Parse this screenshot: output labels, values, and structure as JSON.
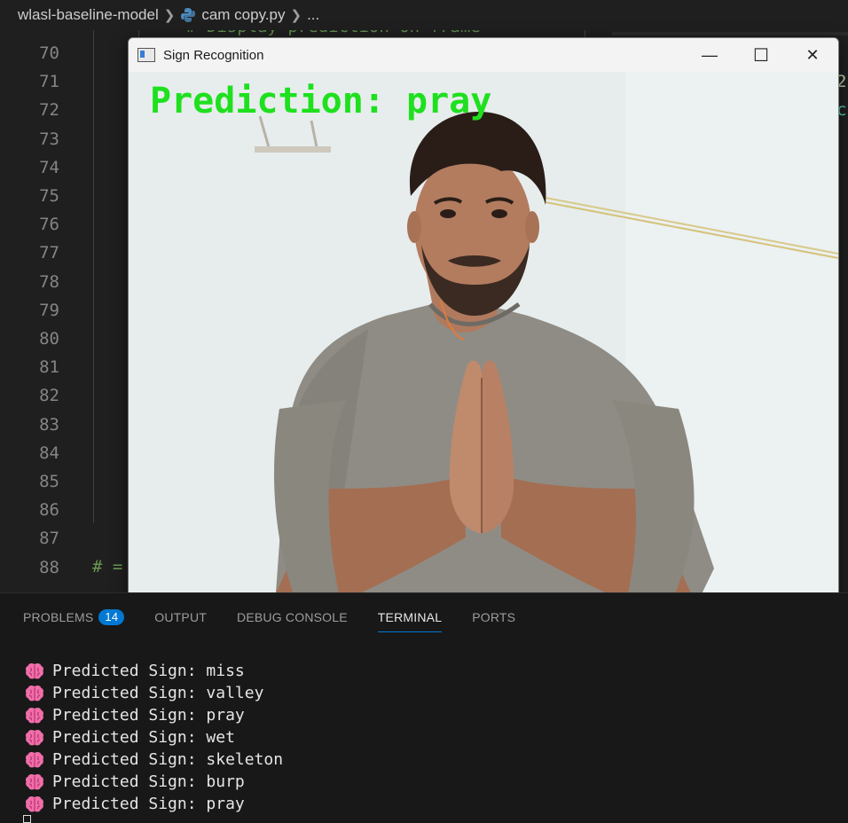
{
  "breadcrumb": {
    "folder": "wlasl-baseline-model",
    "file": "cam copy.py",
    "more": "..."
  },
  "editor": {
    "line_numbers": [
      "70",
      "71",
      "72",
      "73",
      "74",
      "75",
      "76",
      "77",
      "78",
      "79",
      "80",
      "81",
      "82",
      "83",
      "84",
      "85",
      "86",
      "87",
      "88"
    ],
    "partial_top_comment": "# Display prediction on frame",
    "line88_fragment": "# =",
    "right_frag_1": "2",
    "right_frag_2": "c"
  },
  "cv_window": {
    "title": "Sign Recognition",
    "minimize_glyph": "—",
    "maximize_glyph": "☐",
    "close_glyph": "✕",
    "overlay_text": "Prediction: pray",
    "overlay_color": "#1fe01f"
  },
  "panel": {
    "tabs": [
      {
        "label": "PROBLEMS",
        "badge": "14"
      },
      {
        "label": "OUTPUT"
      },
      {
        "label": "DEBUG CONSOLE"
      },
      {
        "label": "TERMINAL"
      },
      {
        "label": "PORTS"
      }
    ],
    "active_tab": "TERMINAL",
    "terminal_lines": [
      "Predicted Sign: miss",
      "Predicted Sign: valley",
      "Predicted Sign: pray",
      "Predicted Sign: wet",
      "Predicted Sign: skeleton",
      "Predicted Sign: burp",
      "Predicted Sign: pray"
    ],
    "line_icon": "brain-icon"
  },
  "colors": {
    "accent": "#0078d4",
    "editor_bg": "#1f1f1f",
    "panel_bg": "#181818"
  }
}
